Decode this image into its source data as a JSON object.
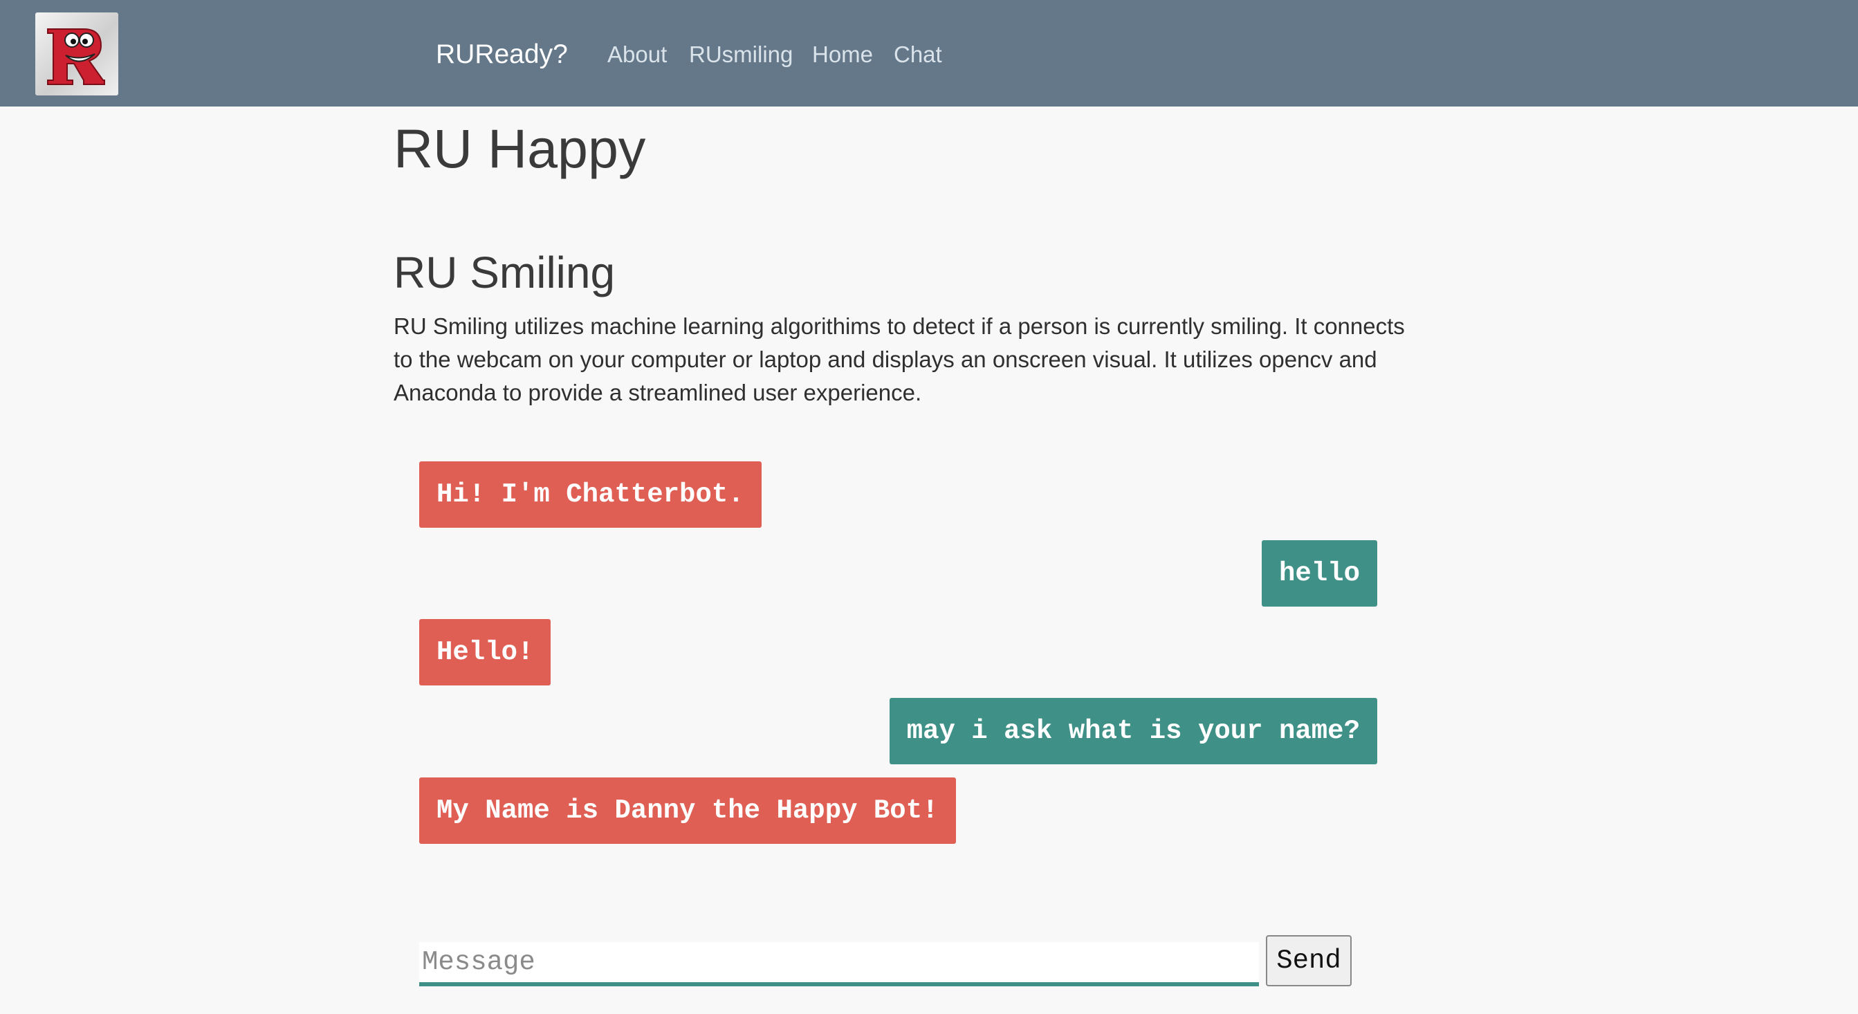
{
  "navbar": {
    "logo_icon": "ru-ready-mascot-logo",
    "brand": "RUReady?",
    "links": [
      "About",
      "RUsmiling",
      "Home",
      "Chat"
    ]
  },
  "main": {
    "title": "RU Happy",
    "section_title": "RU Smiling",
    "description": "RU Smiling utilizes machine learning algorithims to detect if a person is currently smiling. It connects to the webcam on your computer or laptop and displays an onscreen visual. It utilizes opencv and Anaconda to provide a streamlined user experience."
  },
  "chat": {
    "messages": [
      {
        "sender": "bot",
        "text": "Hi! I'm Chatterbot."
      },
      {
        "sender": "user",
        "text": "hello"
      },
      {
        "sender": "bot",
        "text": "Hello!"
      },
      {
        "sender": "user",
        "text": "may i ask what is your name?"
      },
      {
        "sender": "bot",
        "text": "My Name is Danny the Happy Bot!"
      }
    ],
    "input_value": "",
    "input_placeholder": "Message",
    "send_label": "Send"
  },
  "colors": {
    "navbar": "#64788a",
    "bot_bubble": "#e05f55",
    "user_bubble": "#3f9086",
    "background": "#f8f8f8"
  }
}
